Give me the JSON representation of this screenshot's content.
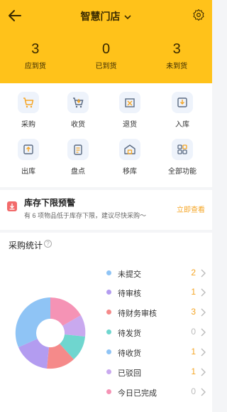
{
  "header": {
    "title": "智慧门店",
    "stats": [
      {
        "value": "3",
        "label": "应到货"
      },
      {
        "value": "0",
        "label": "已到货"
      },
      {
        "value": "3",
        "label": "未到货"
      }
    ]
  },
  "functions": [
    {
      "label": "采购",
      "icon": "shopping-cart-icon"
    },
    {
      "label": "收货",
      "icon": "cart-receive-icon"
    },
    {
      "label": "退货",
      "icon": "return-box-icon"
    },
    {
      "label": "入库",
      "icon": "inbound-icon"
    },
    {
      "label": "出库",
      "icon": "outbound-icon"
    },
    {
      "label": "盘点",
      "icon": "inventory-check-icon"
    },
    {
      "label": "移库",
      "icon": "warehouse-move-icon"
    },
    {
      "label": "全部功能",
      "icon": "grid-apps-icon"
    }
  ],
  "alert": {
    "title": "库存下限预警",
    "desc": "有 6 项物品低于库存下限，建议尽快采购～",
    "link": "立即查看"
  },
  "purchase_stats": {
    "title": "采购统计",
    "help": "?",
    "items": [
      {
        "label": "未提交",
        "count": "2",
        "color": "#8fc4f5"
      },
      {
        "label": "待审核",
        "count": "1",
        "color": "#b39cf0"
      },
      {
        "label": "待财务审核",
        "count": "3",
        "color": "#f58a8a"
      },
      {
        "label": "待发货",
        "count": "0",
        "color": "#6fd6cf"
      },
      {
        "label": "待收货",
        "count": "1",
        "color": "#8fc4f5"
      },
      {
        "label": "已驳回",
        "count": "1",
        "color": "#c9a9ef"
      },
      {
        "label": "今日已完成",
        "count": "0",
        "color": "#f593b5"
      }
    ]
  }
}
